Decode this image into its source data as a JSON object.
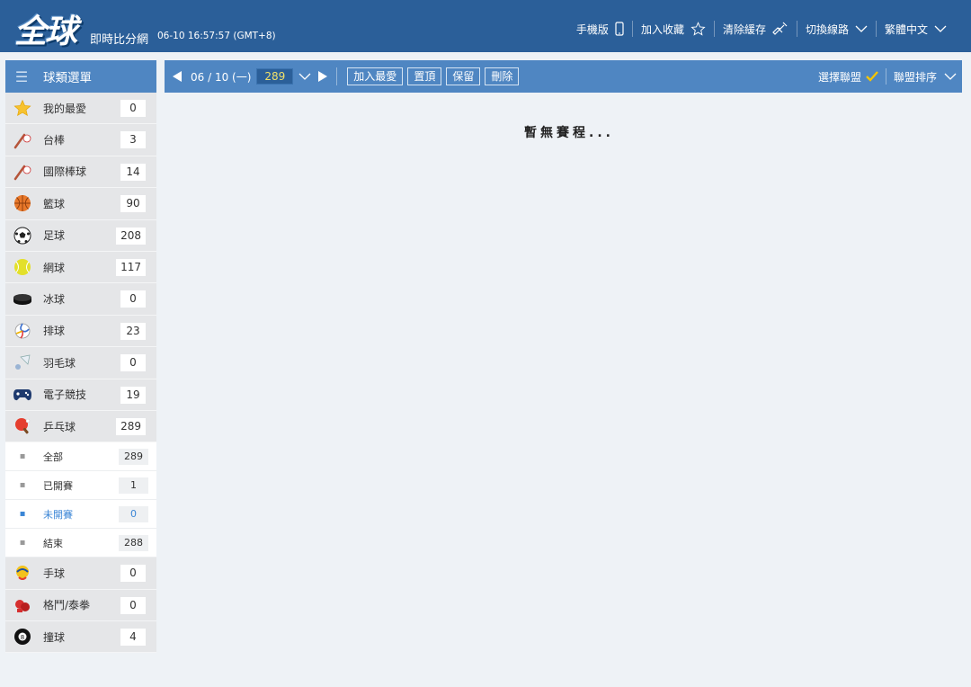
{
  "header": {
    "logo_text": "全球",
    "subtitle": "即時比分網",
    "clock": "06-10 16:57:57 (GMT+8)",
    "links": [
      {
        "label": "手機版",
        "icon": "mobile-icon"
      },
      {
        "label": "加入收藏",
        "icon": "star-outline-icon"
      },
      {
        "label": "清除緩存",
        "icon": "broom-icon"
      },
      {
        "label": "切換線路",
        "icon": "chevron-down-icon"
      },
      {
        "label": "繁體中文",
        "icon": "chevron-down-icon"
      }
    ]
  },
  "sidebar": {
    "title": "球類選單",
    "items": [
      {
        "label": "我的最愛",
        "count": "0",
        "icon": "star-icon"
      },
      {
        "label": "台棒",
        "count": "3",
        "icon": "baseball-icon"
      },
      {
        "label": "國際棒球",
        "count": "14",
        "icon": "baseball-icon"
      },
      {
        "label": "籃球",
        "count": "90",
        "icon": "basketball-icon"
      },
      {
        "label": "足球",
        "count": "208",
        "icon": "soccer-icon"
      },
      {
        "label": "網球",
        "count": "117",
        "icon": "tennis-icon"
      },
      {
        "label": "冰球",
        "count": "0",
        "icon": "hockey-puck-icon"
      },
      {
        "label": "排球",
        "count": "23",
        "icon": "volleyball-icon"
      },
      {
        "label": "羽毛球",
        "count": "0",
        "icon": "shuttlecock-icon"
      },
      {
        "label": "電子競技",
        "count": "19",
        "icon": "gamepad-icon"
      },
      {
        "label": "乒乓球",
        "count": "289",
        "icon": "ping-pong-icon"
      }
    ],
    "subitems": [
      {
        "label": "全部",
        "count": "289"
      },
      {
        "label": "已開賽",
        "count": "1"
      },
      {
        "label": "未開賽",
        "count": "0"
      },
      {
        "label": "結束",
        "count": "288"
      }
    ],
    "items_after": [
      {
        "label": "手球",
        "count": "0",
        "icon": "handball-icon"
      },
      {
        "label": "格鬥/泰拳",
        "count": "0",
        "icon": "boxing-glove-icon"
      },
      {
        "label": "撞球",
        "count": "4",
        "icon": "eight-ball-icon"
      }
    ]
  },
  "toolbar": {
    "date": "06 / 10 (一)",
    "count": "289",
    "buttons": [
      "加入最愛",
      "置頂",
      "保留",
      "刪除"
    ],
    "select_league": "選擇聯盟",
    "league_sort": "聯盟排序"
  },
  "main": {
    "empty_text": "暫無賽程..."
  },
  "colors": {
    "header_bg": "#2b5f99",
    "bar_bg": "#4f86c2",
    "active_blue": "#3b86d6",
    "check_yellow": "#f5c400"
  }
}
